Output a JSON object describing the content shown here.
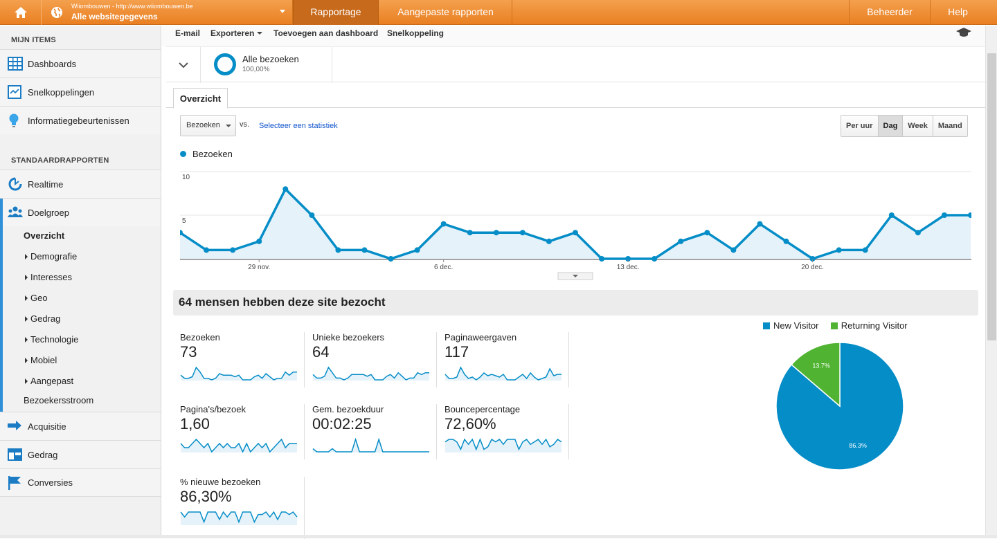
{
  "topbar": {
    "site_line": "Wiiombouwen - http://www.wiiombouwen.be",
    "view_line": "Alle websitegegevens",
    "tabs": [
      "Rapportage",
      "Aangepaste rapporten"
    ],
    "right": [
      "Beheerder",
      "Help"
    ],
    "colors": {
      "bar": "#e97f22",
      "active": "#c76a1c"
    }
  },
  "sidebar": {
    "my_items_heading": "MIJN ITEMS",
    "my_items": [
      {
        "label": "Dashboards",
        "icon": "grid-icon"
      },
      {
        "label": "Snelkoppelingen",
        "icon": "shortcut-icon"
      },
      {
        "label": "Informatiegebeurtenissen",
        "icon": "lightbulb-icon"
      }
    ],
    "std_heading": "STANDAARDRAPPORTEN",
    "realtime": "Realtime",
    "doelgroep": "Doelgroep",
    "doelgroep_sub": {
      "overzicht": "Overzicht",
      "expandable": [
        "Demografie",
        "Interesses",
        "Geo",
        "Gedrag",
        "Technologie",
        "Mobiel",
        "Aangepast"
      ],
      "flow": "Bezoekersstroom"
    },
    "bottom": [
      {
        "label": "Acquisitie",
        "icon": "acquisition-icon"
      },
      {
        "label": "Gedrag",
        "icon": "behavior-icon"
      },
      {
        "label": "Conversies",
        "icon": "flag-icon"
      }
    ]
  },
  "actions": [
    "E-mail",
    "Exporteren",
    "Toevoegen aan dashboard",
    "Snelkoppeling"
  ],
  "segment": {
    "name": "Alle bezoeken",
    "pct": "100,00%"
  },
  "tab": "Overzicht",
  "metric_select": "Bezoeken",
  "vs": "vs.",
  "select_stat": "Selecteer een statistiek",
  "periods": [
    "Per uur",
    "Dag",
    "Week",
    "Maand"
  ],
  "active_period": "Dag",
  "chart_data": {
    "type": "area",
    "series": [
      {
        "name": "Bezoeken",
        "values": [
          3,
          1,
          1,
          2,
          8,
          5,
          1,
          1,
          0,
          1,
          4,
          3,
          3,
          3,
          2,
          3,
          0,
          0,
          0,
          2,
          3,
          1,
          4,
          2,
          0,
          1,
          1,
          5,
          3,
          5,
          5
        ]
      }
    ],
    "ylim": [
      0,
      10
    ],
    "yticks": [
      "10",
      "5"
    ],
    "xticks": [
      {
        "label": "29 nov.",
        "index": 3
      },
      {
        "label": "6 dec.",
        "index": 10
      },
      {
        "label": "13 dec.",
        "index": 17
      },
      {
        "label": "20 dec.",
        "index": 24
      }
    ],
    "color": "#058dc7",
    "fill": "#e6f2fa"
  },
  "summary_title": "64 mensen hebben deze site bezocht",
  "tiles": [
    {
      "label": "Bezoeken",
      "value": "73",
      "spark": [
        3,
        1,
        1,
        2,
        8,
        5,
        1,
        1,
        0,
        1,
        4,
        3,
        3,
        3,
        2,
        3,
        0,
        0,
        0,
        2,
        3,
        1,
        4,
        2,
        0,
        1,
        1,
        5,
        3,
        5,
        5
      ]
    },
    {
      "label": "Unieke bezoekers",
      "value": "64",
      "spark": [
        3,
        1,
        1,
        2,
        7,
        4,
        1,
        1,
        0,
        1,
        3,
        3,
        3,
        3,
        2,
        3,
        0,
        0,
        0,
        2,
        3,
        1,
        4,
        2,
        0,
        1,
        1,
        4,
        3,
        4,
        4
      ]
    },
    {
      "label": "Paginaweergaven",
      "value": "117",
      "spark": [
        4,
        1,
        1,
        2,
        9,
        4,
        1,
        2,
        0,
        2,
        5,
        3,
        4,
        3,
        2,
        4,
        0,
        0,
        0,
        2,
        4,
        1,
        5,
        2,
        0,
        1,
        2,
        8,
        3,
        4,
        4
      ]
    },
    {
      "label": "Pagina's/bezoek",
      "value": "1,60",
      "spark": [
        2,
        1,
        1,
        2,
        3,
        2,
        1,
        2,
        0,
        1,
        2,
        1,
        2,
        1,
        1,
        2,
        0,
        2,
        0,
        1,
        2,
        1,
        2,
        0,
        1,
        2,
        3,
        1,
        2,
        2,
        2
      ]
    },
    {
      "label": "Gem. bezoekduur",
      "value": "00:02:25",
      "spark": [
        1,
        0,
        0,
        0,
        0,
        1,
        0,
        0,
        0,
        0,
        0,
        4,
        0,
        0,
        0,
        0,
        0,
        4,
        0,
        0,
        0,
        0,
        0,
        0,
        0,
        0,
        0,
        0,
        0,
        0,
        0
      ]
    },
    {
      "label": "Bouncepercentage",
      "value": "72,60%",
      "spark": [
        4,
        5,
        5,
        4,
        1,
        5,
        3,
        5,
        1,
        5,
        1,
        2,
        5,
        4,
        5,
        3,
        5,
        5,
        5,
        1,
        4,
        5,
        3,
        4,
        5,
        3,
        5,
        2,
        3,
        5,
        4
      ]
    },
    {
      "label": "% nieuwe bezoeken",
      "value": "86,30%",
      "spark": [
        5,
        3,
        5,
        5,
        5,
        5,
        1,
        5,
        5,
        5,
        2,
        5,
        3,
        5,
        5,
        1,
        5,
        5,
        5,
        1,
        4,
        4,
        5,
        3,
        5,
        2,
        5,
        5,
        4,
        5,
        3
      ]
    }
  ],
  "pie": {
    "legend": [
      "New Visitor",
      "Returning Visitor"
    ],
    "colors": [
      "#058dc7",
      "#50b432"
    ],
    "values": [
      86.3,
      13.7
    ],
    "labels": [
      "86.3%",
      "13.7%"
    ]
  }
}
